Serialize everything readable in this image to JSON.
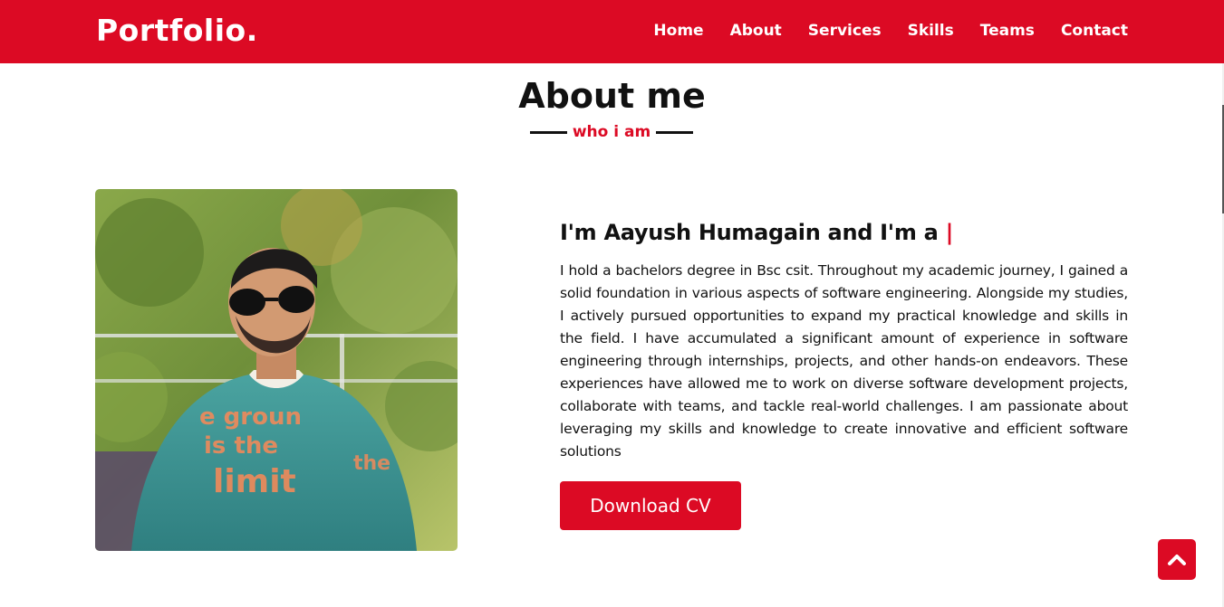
{
  "nav": {
    "logo": "Portfolio.",
    "items": [
      {
        "label": "Home"
      },
      {
        "label": "About"
      },
      {
        "label": "Services"
      },
      {
        "label": "Skills"
      },
      {
        "label": "Teams"
      },
      {
        "label": "Contact"
      }
    ]
  },
  "about": {
    "title": "About me",
    "subtitle": "who i am",
    "heading": "I'm Aayush Humagain and I'm a ",
    "cursor": "|",
    "text": "I hold a bachelors degree in Bsc csit. Throughout my academic journey, I gained a solid foundation in various aspects of software engineering. Alongside my studies, I actively pursued opportunities to expand my practical knowledge and skills in the field. I have accumulated a significant amount of experience in software engineering through internships, projects, and other hands-on endeavors. These experiences have allowed me to work on diverse software development projects, collaborate with teams, and tackle real-world challenges. I am passionate about leveraging my skills and knowledge to create innovative and efficient software solutions",
    "button_label": "Download CV",
    "photo_icon": "profile-photo"
  },
  "scroll_top_icon": "chevron-up-icon",
  "colors": {
    "accent": "#dc0a24",
    "text": "#111111",
    "background": "#ffffff"
  }
}
